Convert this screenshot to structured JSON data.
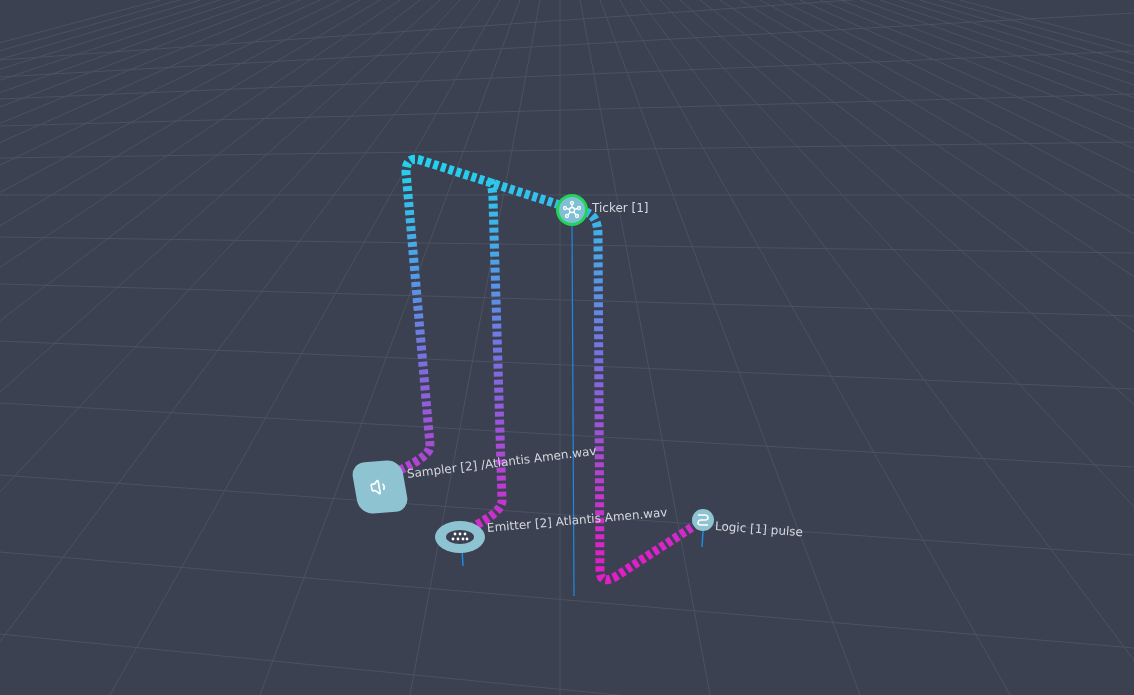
{
  "nodes": [
    {
      "kind": "ticker",
      "label": "Ticker [1]",
      "selected": true
    },
    {
      "kind": "sampler",
      "label": "Sampler [2] /Atlantis Amen.wav",
      "selected": false
    },
    {
      "kind": "emitter",
      "label": "Emitter [2] Atlantis Amen.wav",
      "selected": false
    },
    {
      "kind": "logic",
      "label": "Logic [1] pulse",
      "selected": false
    }
  ]
}
